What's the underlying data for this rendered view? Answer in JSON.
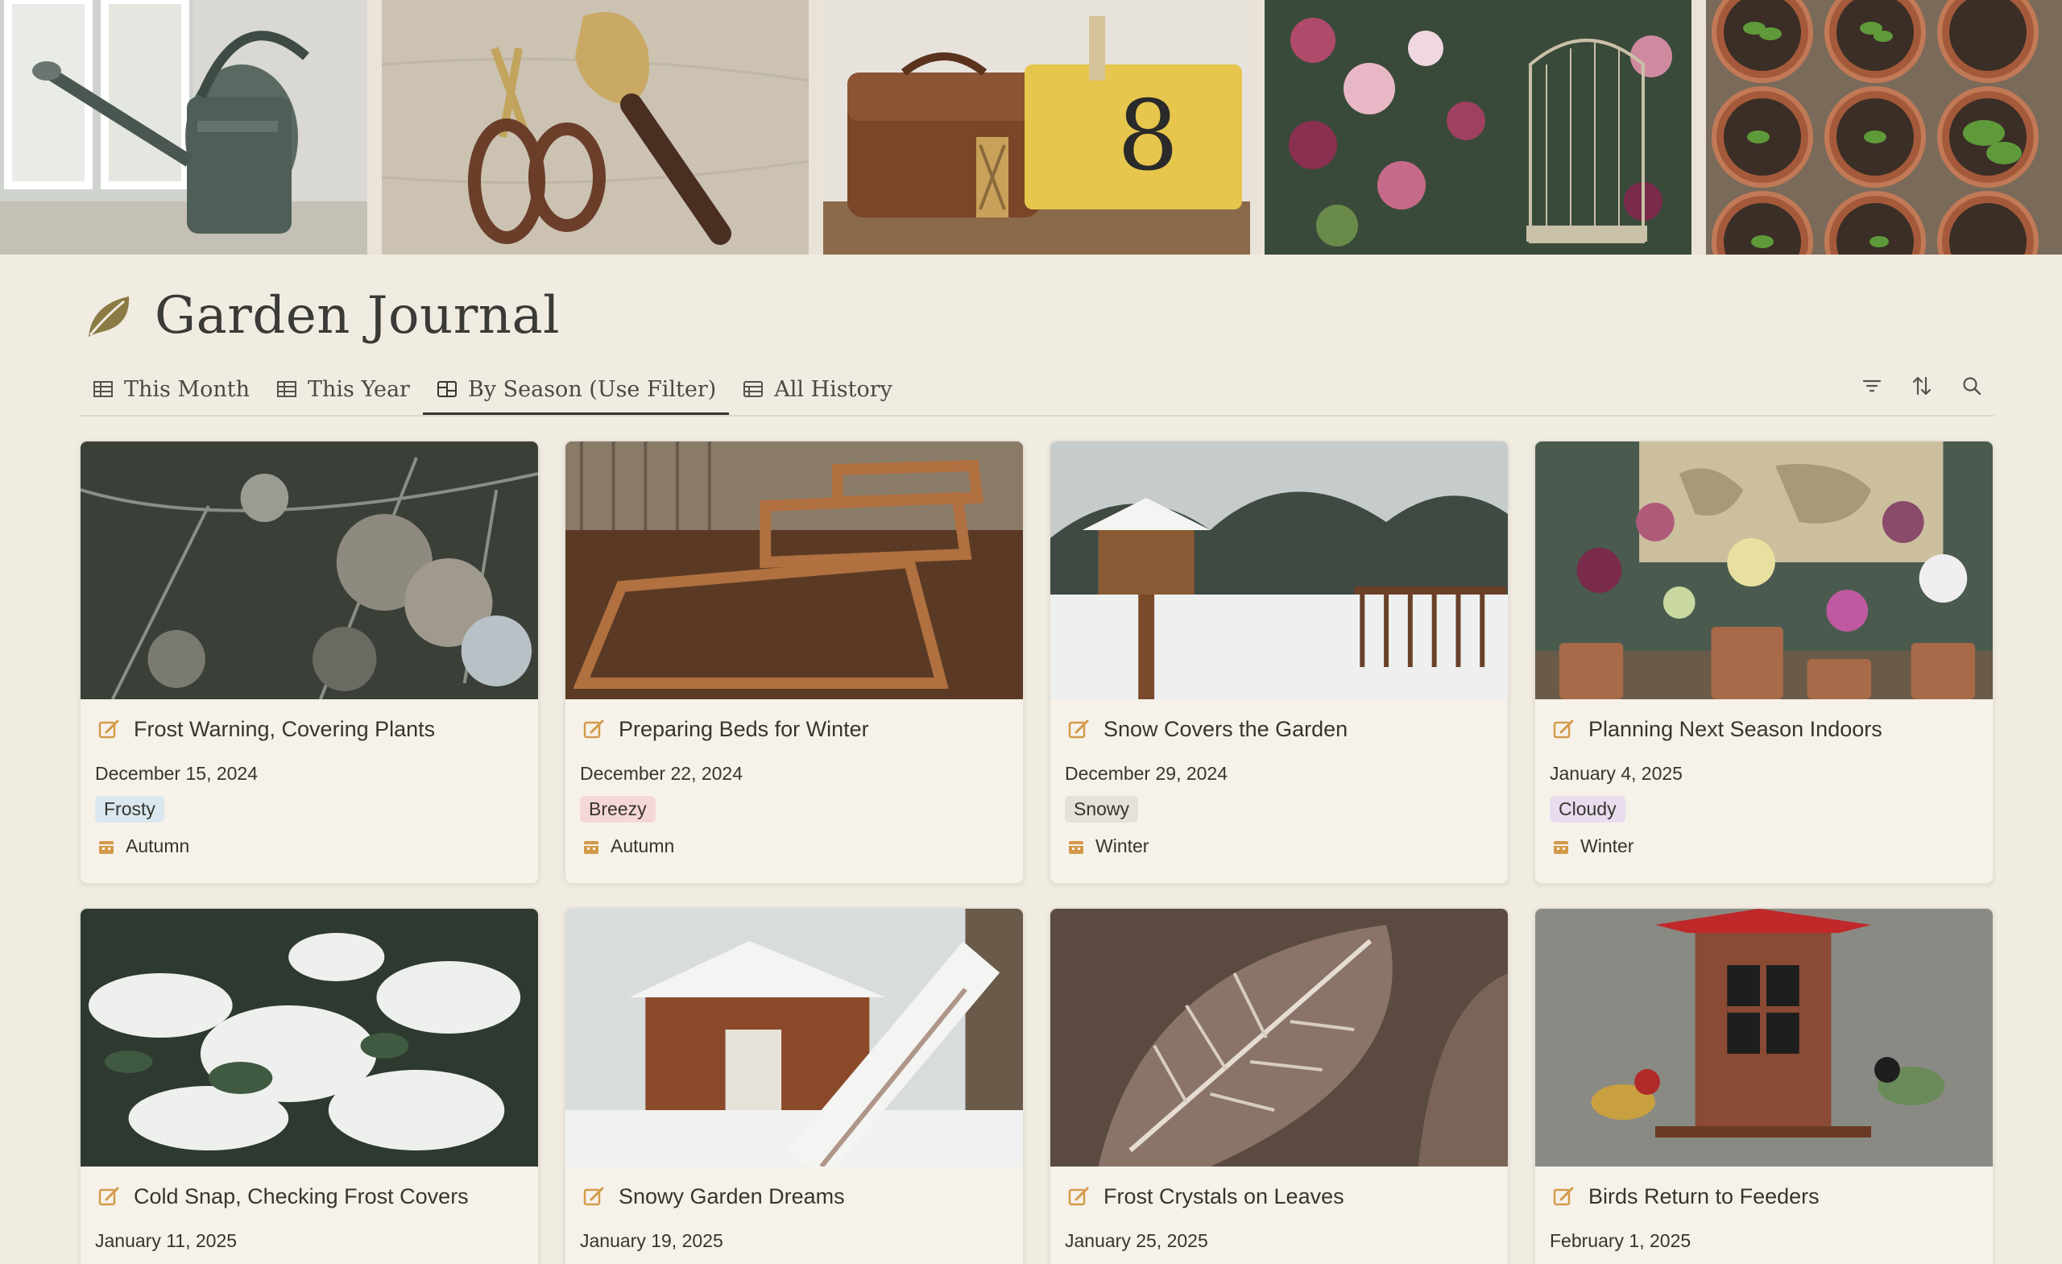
{
  "page": {
    "title": "Garden Journal"
  },
  "banner": {
    "images": [
      {
        "name": "watering-can-photo"
      },
      {
        "name": "garden-shears-trowel-photo"
      },
      {
        "name": "satchel-bucket-photo"
      },
      {
        "name": "flowers-birdcage-photo"
      },
      {
        "name": "seedling-pots-photo"
      }
    ]
  },
  "tabs": [
    {
      "label": "This Month",
      "icon": "table-icon",
      "active": false
    },
    {
      "label": "This Year",
      "icon": "table-icon",
      "active": false
    },
    {
      "label": "By Season (Use Filter)",
      "icon": "board-icon",
      "active": true
    },
    {
      "label": "All History",
      "icon": "list-icon",
      "active": false
    }
  ],
  "toolbar": {
    "icons": [
      "filter-icon",
      "sort-icon",
      "search-icon"
    ]
  },
  "colors": {
    "tag_frosty": "#dbe7ef",
    "tag_breezy": "#f6d7d8",
    "tag_snowy": "#e6e2db",
    "tag_cloudy": "#e8dcee",
    "accent_icon": "#d39a4a"
  },
  "cards": [
    {
      "title": "Frost Warning, Covering Plants",
      "date": "December 15, 2024",
      "tag": "Frosty",
      "tag_color": "#dbe7ef",
      "season": "Autumn",
      "image": "frosted-branches"
    },
    {
      "title": "Preparing Beds for Winter",
      "date": "December 22, 2024",
      "tag": "Breezy",
      "tag_color": "#f6d7d8",
      "season": "Autumn",
      "image": "raised-beds"
    },
    {
      "title": "Snow Covers the Garden",
      "date": "December 29, 2024",
      "tag": "Snowy",
      "tag_color": "#e6e2db",
      "season": "Winter",
      "image": "snowy-birdhouse"
    },
    {
      "title": "Planning Next Season Indoors",
      "date": "January 4, 2025",
      "tag": "Cloudy",
      "tag_color": "#e8dcee",
      "season": "Winter",
      "image": "indoor-plants-map"
    },
    {
      "title": "Cold Snap, Checking Frost Covers",
      "date": "January 11, 2025",
      "image": "snow-leaves"
    },
    {
      "title": "Snowy Garden Dreams",
      "date": "January 19, 2025",
      "image": "snowy-shed"
    },
    {
      "title": "Frost Crystals on Leaves",
      "date": "January 25, 2025",
      "image": "frost-leaf"
    },
    {
      "title": "Birds Return to Feeders",
      "date": "February 1, 2025",
      "image": "bird-feeder"
    }
  ]
}
